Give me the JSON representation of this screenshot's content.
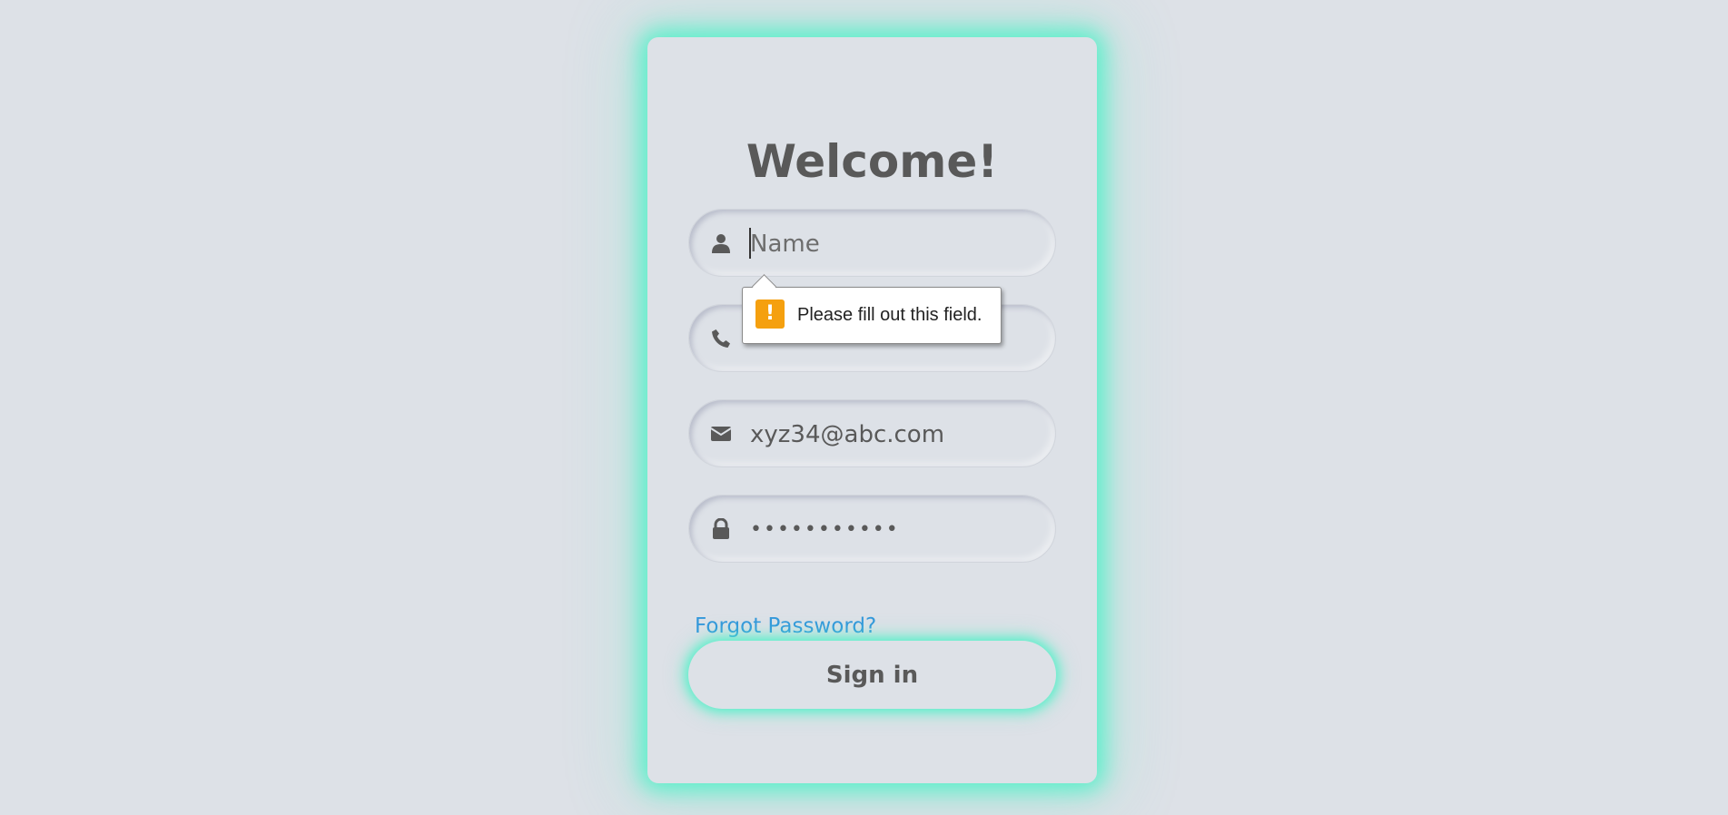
{
  "form": {
    "title": "Welcome!",
    "name_field": {
      "placeholder": "Name",
      "value": ""
    },
    "phone_field": {
      "placeholder": "",
      "value": ""
    },
    "email_field": {
      "value": "xyz34@abc.com"
    },
    "password_field": {
      "value": "passwordxxx"
    },
    "forgot_password_label": "Forgot Password?",
    "signin_label": "Sign in"
  },
  "validation_tooltip": {
    "message": "Please fill out this field.",
    "icon": "exclamation-icon"
  },
  "colors": {
    "background": "#dde1e7",
    "glow": "#52f0c8",
    "link": "#3498db",
    "text": "#595959",
    "warning": "#f5a00f"
  },
  "icons": [
    "user-icon",
    "phone-icon",
    "envelope-icon",
    "lock-icon"
  ]
}
